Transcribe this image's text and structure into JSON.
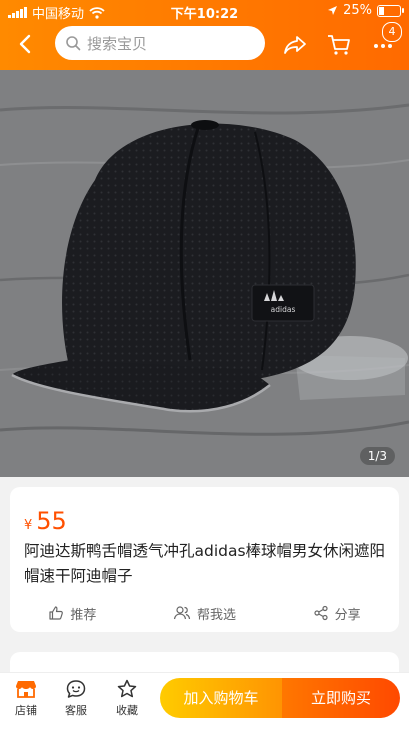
{
  "status_bar": {
    "carrier": "中国移动",
    "time": "下午10:22",
    "battery": "25%",
    "battery_level": 0.25
  },
  "nav": {
    "search_placeholder": "搜索宝贝",
    "cart_badge": "4"
  },
  "gallery": {
    "counter": "1/3",
    "logo_text": "adidas"
  },
  "product": {
    "currency": "¥",
    "price": "55",
    "title": "阿迪达斯鸭舌帽透气冲孔adidas棒球帽男女休闲遮阳帽速干阿迪帽子",
    "actions": {
      "recommend": "推荐",
      "help_choose": "帮我选",
      "share": "分享"
    }
  },
  "bottom_bar": {
    "shop": "店铺",
    "service": "客服",
    "favorite": "收藏",
    "add_to_cart": "加入购物车",
    "buy_now": "立即购买"
  },
  "colors": {
    "brand_orange": "#ff6a00",
    "price_orange": "#ff5000",
    "cart_button": "#ffa200",
    "buy_button": "#ff5500"
  }
}
